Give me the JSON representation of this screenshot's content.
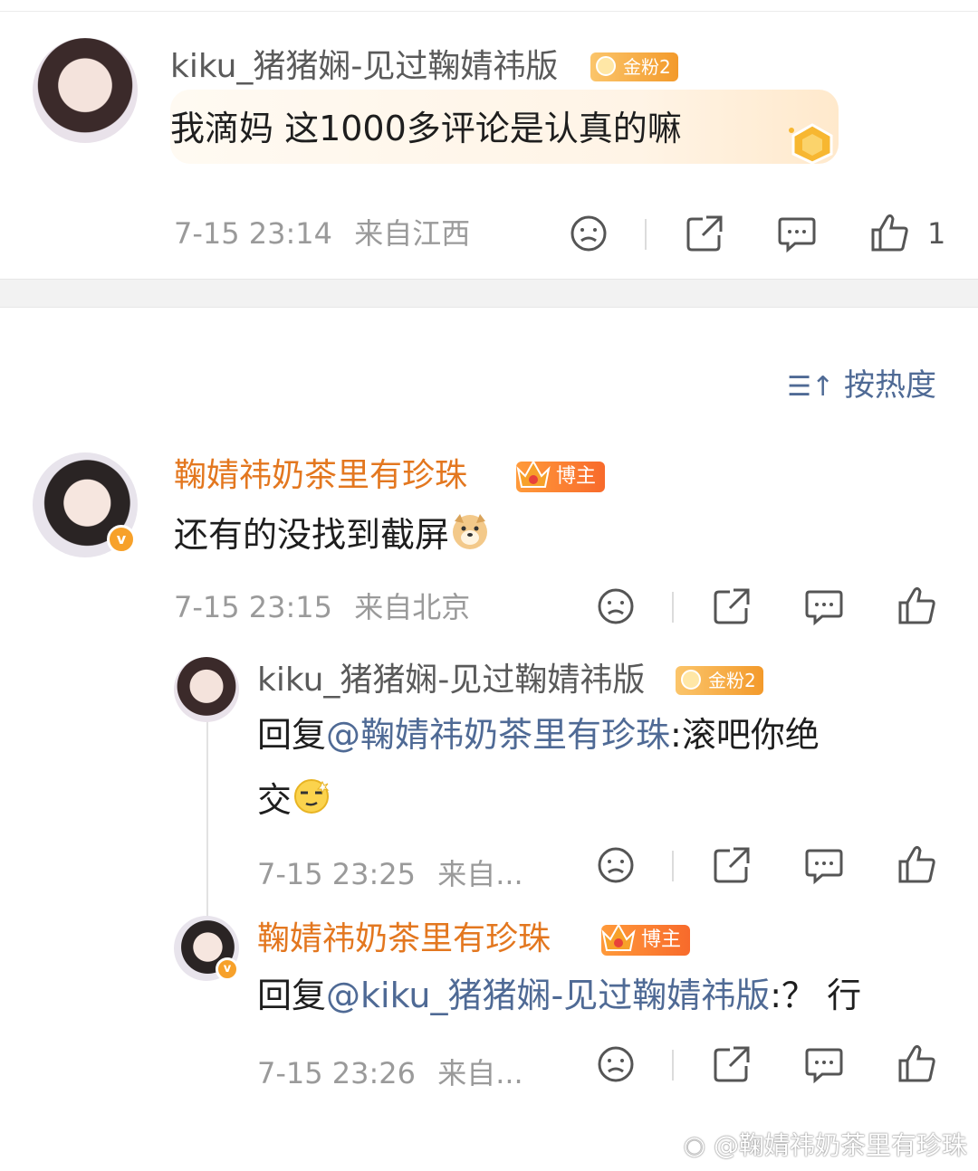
{
  "top_comment": {
    "username": "kiku_猪猪娴-见过鞠婧祎版",
    "badge": "金粉2",
    "text": "我滴妈 这1000多评论是认真的嘛",
    "timestamp": "7-15 23:14",
    "location": "来自江西",
    "like_count": "1"
  },
  "sort": {
    "label": "按热度"
  },
  "main_comment": {
    "username": "鞠婧祎奶茶里有珍珠",
    "badge": "博主",
    "text": "还有的没找到截屏",
    "timestamp": "7-15 23:15",
    "location": "来自北京"
  },
  "replies": [
    {
      "username": "kiku_猪猪娴-见过鞠婧祎版",
      "badge": "金粉2",
      "prefix": "回复",
      "mention": "@鞠婧祎奶茶里有珍珠",
      "text_line1": ":滚吧你绝",
      "text_line2": "交",
      "timestamp": "7-15 23:25",
      "location": "来自..."
    },
    {
      "username": "鞠婧祎奶茶里有珍珠",
      "badge": "博主",
      "prefix": "回复",
      "mention": "@kiku_猪猪娴-见过鞠婧祎版",
      "text": ":？ 行",
      "timestamp": "7-15 23:26",
      "location": "来自..."
    }
  ],
  "watermark": "@鞠婧祎奶茶里有珍珠",
  "colors": {
    "accent_orange": "#e3771f",
    "mention_blue": "#4f6a95",
    "meta_gray": "#9a9a9a"
  }
}
